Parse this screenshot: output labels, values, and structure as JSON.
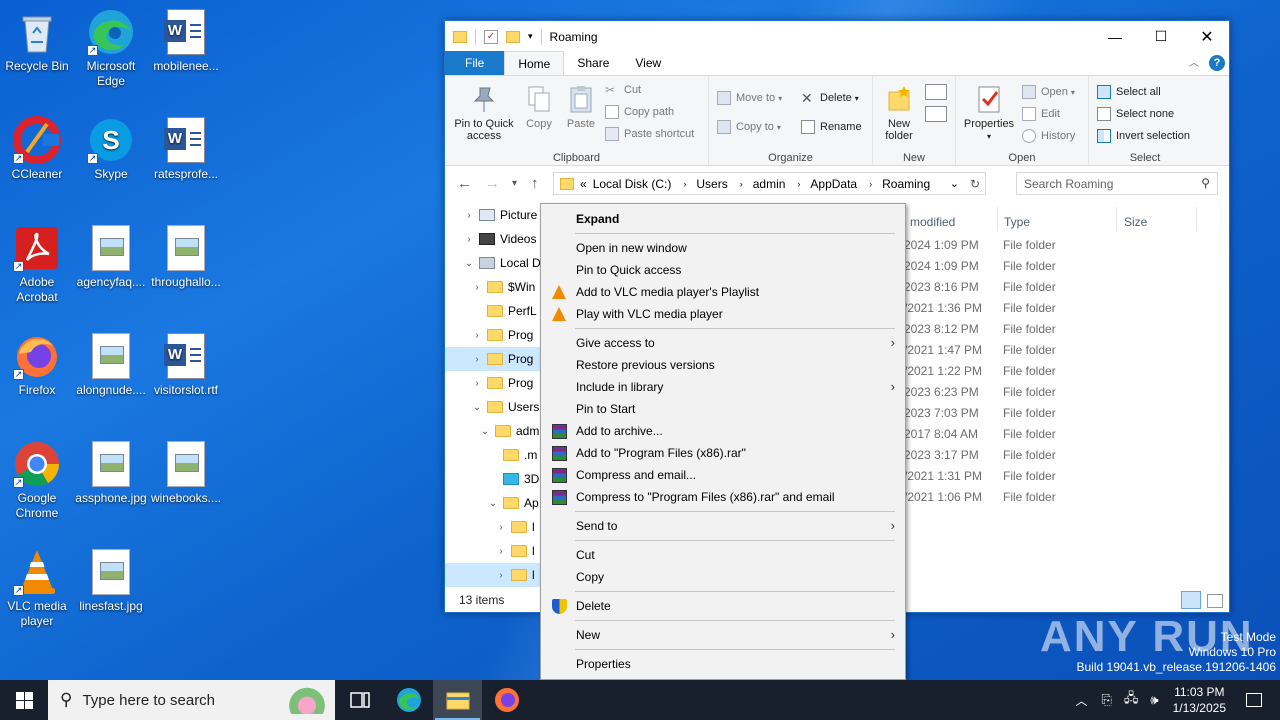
{
  "desktop": {
    "icons": [
      {
        "label": "Recycle Bin"
      },
      {
        "label": "Microsoft Edge"
      },
      {
        "label": "mobilenee..."
      },
      {
        "label": "CCleaner"
      },
      {
        "label": "Skype"
      },
      {
        "label": "ratesprofe..."
      },
      {
        "label": "Adobe Acrobat"
      },
      {
        "label": "agencyfaq...."
      },
      {
        "label": "throughallo..."
      },
      {
        "label": "Firefox"
      },
      {
        "label": "alongnude...."
      },
      {
        "label": "visitorslot.rtf"
      },
      {
        "label": "Google Chrome"
      },
      {
        "label": "assphone.jpg"
      },
      {
        "label": "winebooks...."
      },
      {
        "label": "VLC media player"
      },
      {
        "label": "linesfast.jpg"
      }
    ]
  },
  "explorer": {
    "title": "Roaming",
    "ribbon_tabs": [
      "File",
      "Home",
      "Share",
      "View"
    ],
    "clipboard": {
      "pin": "Pin to Quick access",
      "copy": "Copy",
      "paste": "Paste",
      "cut": "Cut",
      "copy_path": "Copy path",
      "paste_shortcut": "Paste shortcut",
      "label": "Clipboard"
    },
    "organize": {
      "move_to": "Move to",
      "copy_to": "Copy to",
      "delete": "Delete",
      "rename": "Rename",
      "label": "Organize"
    },
    "new": {
      "new_folder": "New folder",
      "label": "New"
    },
    "open": {
      "properties": "Properties",
      "open": "Open",
      "edit": "Edit",
      "history": "History",
      "label": "Open"
    },
    "select": {
      "select_all": "Select all",
      "select_none": "Select none",
      "invert": "Invert selection",
      "label": "Select"
    },
    "address": {
      "prefix": "«",
      "crumbs": [
        "Local Disk (C:)",
        "Users",
        "admin",
        "AppData",
        "Roaming"
      ],
      "search_placeholder": "Search Roaming"
    },
    "tree": [
      {
        "label": "Picture"
      },
      {
        "label": "Videos"
      },
      {
        "label": "Local D"
      },
      {
        "label": "$Win"
      },
      {
        "label": "PerfL"
      },
      {
        "label": "Prog"
      },
      {
        "label": "Prog"
      },
      {
        "label": "Prog"
      },
      {
        "label": "Users"
      },
      {
        "label": "adm"
      },
      {
        "label": ".m"
      },
      {
        "label": "3D"
      },
      {
        "label": "Ap"
      },
      {
        "label": "l"
      },
      {
        "label": "l"
      },
      {
        "label": "l"
      }
    ],
    "columns": {
      "modified": "modified",
      "type": "Type",
      "size": "Size"
    },
    "rows": [
      {
        "date": "2024 1:09 PM",
        "type": "File folder"
      },
      {
        "date": "2024 1:09 PM",
        "type": "File folder"
      },
      {
        "date": "2023 8:16 PM",
        "type": "File folder"
      },
      {
        "date": "/2021 1:36 PM",
        "type": "File folder"
      },
      {
        "date": "2023 8:12 PM",
        "type": "File folder"
      },
      {
        "date": "/2021 1:47 PM",
        "type": "File folder"
      },
      {
        "date": "/2021 1:22 PM",
        "type": "File folder"
      },
      {
        "date": "2023 6:23 PM",
        "type": "File folder"
      },
      {
        "date": "2023 7:03 PM",
        "type": "File folder"
      },
      {
        "date": "2017 8:04 AM",
        "type": "File folder"
      },
      {
        "date": "2023 3:17 PM",
        "type": "File folder"
      },
      {
        "date": "/2021 1:31 PM",
        "type": "File folder"
      },
      {
        "date": "/2021 1:06 PM",
        "type": "File folder"
      }
    ],
    "status": "13 items"
  },
  "context_menu": {
    "expand": "Expand",
    "open_new_window": "Open in new window",
    "pin_quick": "Pin to Quick access",
    "vlc_playlist": "Add to VLC media player's Playlist",
    "vlc_play": "Play with VLC media player",
    "give_access": "Give access to",
    "restore": "Restore previous versions",
    "include_library": "Include in library",
    "pin_start": "Pin to Start",
    "add_archive": "Add to archive...",
    "add_rar": "Add to \"Program Files (x86).rar\"",
    "compress_email": "Compress and email...",
    "compress_rar_email": "Compress to \"Program Files (x86).rar\" and email",
    "send_to": "Send to",
    "cut": "Cut",
    "copy": "Copy",
    "delete": "Delete",
    "new": "New",
    "properties": "Properties"
  },
  "taskbar": {
    "search_placeholder": "Type here to search",
    "time": "11:03 PM",
    "date": "1/13/2025"
  },
  "watermark": {
    "brand": "ANY RUN",
    "mode": "Test Mode",
    "os": "Windows 10 Pro",
    "build": "Build 19041.vb_release.191206-1406"
  }
}
